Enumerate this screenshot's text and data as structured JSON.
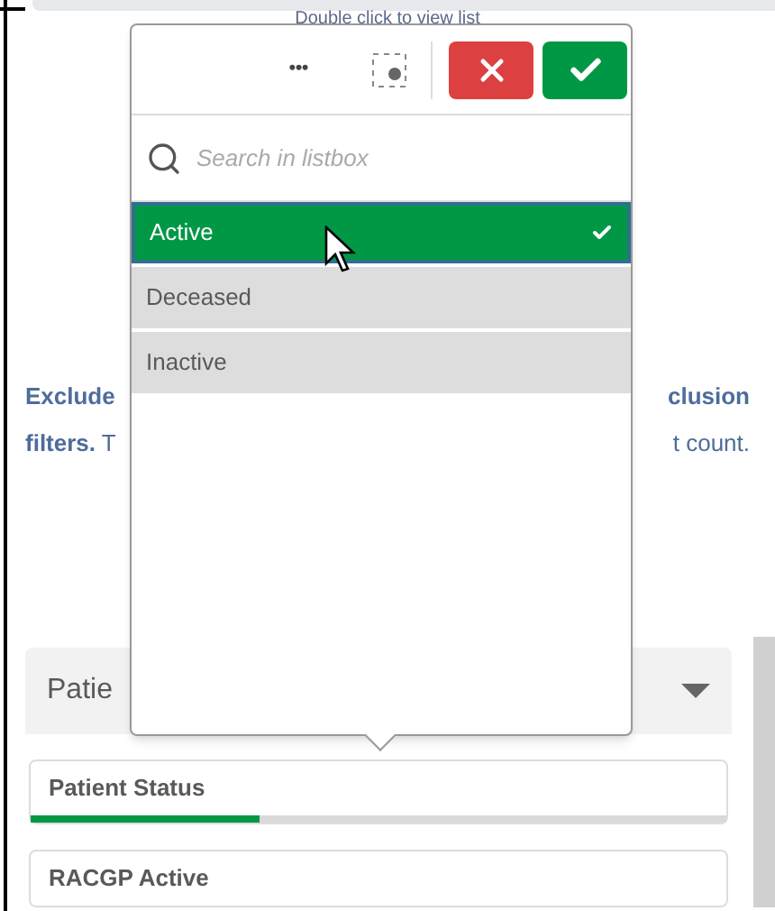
{
  "hint": "Double click to view list",
  "note": {
    "left_lines": [
      {
        "bold": "Exclude"
      },
      {
        "bold": "filters.",
        "rest": " T"
      }
    ],
    "right_lines": [
      {
        "bold": "clusion"
      },
      {
        "rest": "t count."
      }
    ]
  },
  "panel": {
    "title": "Patie",
    "expanded": true
  },
  "filters": [
    {
      "label": "Patient Status",
      "level": 0.33
    },
    {
      "label": "RACGP Active"
    }
  ],
  "listbox": {
    "search": {
      "placeholder": "Search in listbox"
    },
    "more": "•••",
    "items": [
      {
        "label": "Active",
        "selected": true
      },
      {
        "label": "Deceased",
        "selected": false
      },
      {
        "label": "Inactive",
        "selected": false
      }
    ]
  }
}
